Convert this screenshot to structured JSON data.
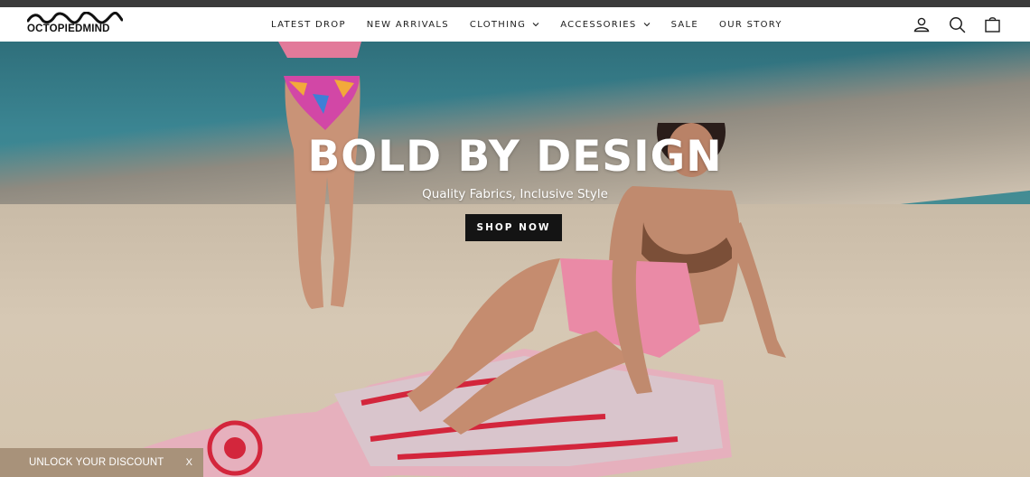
{
  "brand": {
    "logo_text": "OCTOPIEDMIND"
  },
  "nav": {
    "items": [
      {
        "label": "LATEST DROP",
        "has_dropdown": false
      },
      {
        "label": "NEW ARRIVALS",
        "has_dropdown": false
      },
      {
        "label": "CLOTHING",
        "has_dropdown": true
      },
      {
        "label": "ACCESSORIES",
        "has_dropdown": true
      },
      {
        "label": "SALE",
        "has_dropdown": false
      },
      {
        "label": "OUR STORY",
        "has_dropdown": false
      }
    ]
  },
  "header_icons": [
    "account-icon",
    "search-icon",
    "cart-icon"
  ],
  "hero": {
    "title": "BOLD BY DESIGN",
    "subtitle": "Quality Fabrics, Inclusive Style",
    "cta_label": "SHOP NOW"
  },
  "discount_tab": {
    "label": "UNLOCK YOUR DISCOUNT",
    "close": "X"
  },
  "colors": {
    "topbar": "#3b3b3b",
    "header_bg": "#ffffff",
    "cta_bg": "#141414",
    "discount_bg": "#a8927a",
    "text_dark": "#1c1c1c"
  }
}
